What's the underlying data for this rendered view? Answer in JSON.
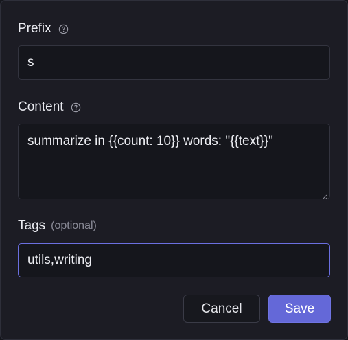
{
  "form": {
    "prefix": {
      "label": "Prefix",
      "value": "s"
    },
    "content": {
      "label": "Content",
      "value": "summarize in {{count: 10}} words: \"{{text}}\""
    },
    "tags": {
      "label": "Tags",
      "optional": "(optional)",
      "value": "utils,writing"
    }
  },
  "actions": {
    "cancel_label": "Cancel",
    "save_label": "Save"
  },
  "colors": {
    "accent": "#6468d8",
    "background": "#1c1c24",
    "field_background": "#15161c"
  },
  "icons": {
    "help": "help-circle-icon",
    "resize": "resize-grip-icon"
  }
}
